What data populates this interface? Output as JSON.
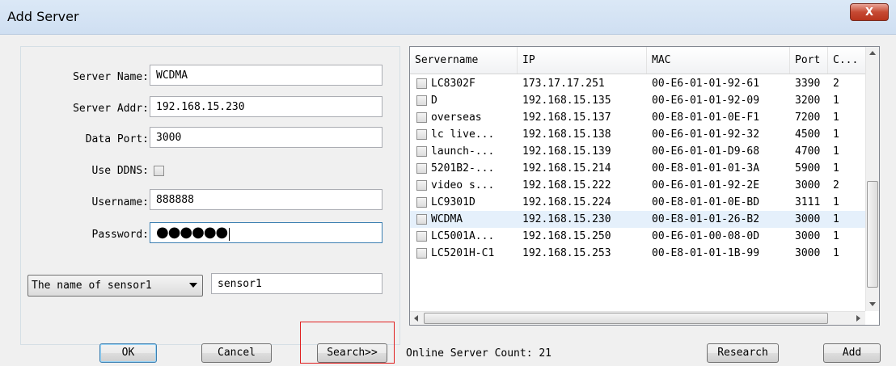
{
  "window": {
    "title": "Add Server",
    "close_label": "X"
  },
  "form": {
    "server_name_label": "Server Name:",
    "server_name_value": "WCDMA",
    "server_addr_label": "Server Addr:",
    "server_addr_value": "192.168.15.230",
    "data_port_label": "Data Port:",
    "data_port_value": "3000",
    "use_ddns_label": "Use DDNS:",
    "use_ddns_checked": false,
    "username_label": "Username:",
    "username_value": "888888",
    "password_label": "Password:",
    "password_value": "●●●●●●",
    "sensor_select_value": "The name of sensor1",
    "sensor_value": "sensor1"
  },
  "buttons": {
    "ok": "OK",
    "cancel": "Cancel",
    "search": "Search>>",
    "research": "Research",
    "add": "Add"
  },
  "status": {
    "online_count": "Online Server Count: 21"
  },
  "server_list": {
    "columns": [
      "Servername",
      "IP",
      "MAC",
      "Port",
      "C..."
    ],
    "rows": [
      {
        "name": "LC8302F",
        "ip": "173.17.17.251",
        "mac": "00-E6-01-01-92-61",
        "port": "3390",
        "c": "2"
      },
      {
        "name": "D",
        "ip": "192.168.15.135",
        "mac": "00-E6-01-01-92-09",
        "port": "3200",
        "c": "1"
      },
      {
        "name": "overseas",
        "ip": "192.168.15.137",
        "mac": "00-E8-01-01-0E-F1",
        "port": "7200",
        "c": "1"
      },
      {
        "name": "lc live...",
        "ip": "192.168.15.138",
        "mac": "00-E6-01-01-92-32",
        "port": "4500",
        "c": "1"
      },
      {
        "name": "launch-...",
        "ip": "192.168.15.139",
        "mac": "00-E6-01-01-D9-68",
        "port": "4700",
        "c": "1"
      },
      {
        "name": "5201B2-...",
        "ip": "192.168.15.214",
        "mac": "00-E8-01-01-01-3A",
        "port": "5900",
        "c": "1"
      },
      {
        "name": "video s...",
        "ip": "192.168.15.222",
        "mac": "00-E6-01-01-92-2E",
        "port": "3000",
        "c": "2"
      },
      {
        "name": "LC9301D",
        "ip": "192.168.15.224",
        "mac": "00-E8-01-01-0E-BD",
        "port": "3111",
        "c": "1"
      },
      {
        "name": "WCDMA",
        "ip": "192.168.15.230",
        "mac": "00-E8-01-01-26-B2",
        "port": "3000",
        "c": "1"
      },
      {
        "name": "LC5001A...",
        "ip": "192.168.15.250",
        "mac": "00-E6-01-00-08-0D",
        "port": "3000",
        "c": "1"
      },
      {
        "name": "LC5201H-C1",
        "ip": "192.168.15.253",
        "mac": "00-E8-01-01-1B-99",
        "port": "3000",
        "c": "1"
      }
    ],
    "selected_name": "WCDMA"
  }
}
